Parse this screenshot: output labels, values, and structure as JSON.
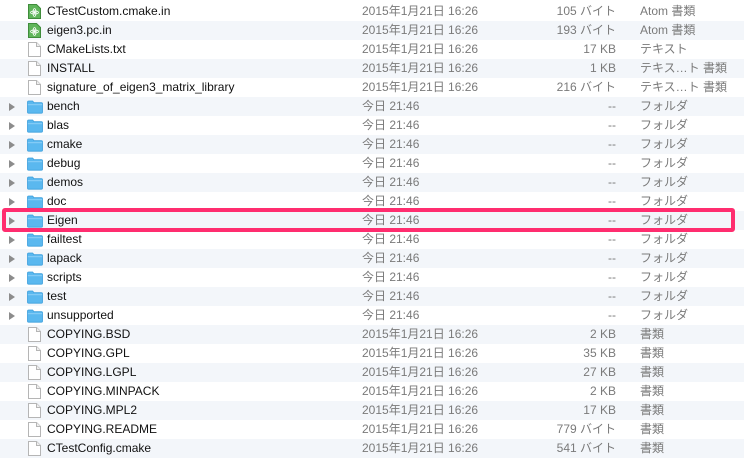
{
  "files": [
    {
      "name": "CTestCustom.cmake.in",
      "date": "2015年1月21日 16:26",
      "size": "105 バイト",
      "kind": "Atom 書類",
      "icon": "atom-document-icon",
      "folder": false
    },
    {
      "name": "eigen3.pc.in",
      "date": "2015年1月21日 16:26",
      "size": "193 バイト",
      "kind": "Atom 書類",
      "icon": "atom-document-icon",
      "folder": false
    },
    {
      "name": "CMakeLists.txt",
      "date": "2015年1月21日 16:26",
      "size": "17 KB",
      "kind": "テキスト",
      "icon": "document-icon",
      "folder": false
    },
    {
      "name": "INSTALL",
      "date": "2015年1月21日 16:26",
      "size": "1 KB",
      "kind": "テキス…ト 書類",
      "icon": "document-icon",
      "folder": false
    },
    {
      "name": "signature_of_eigen3_matrix_library",
      "date": "2015年1月21日 16:26",
      "size": "216 バイト",
      "kind": "テキス…ト 書類",
      "icon": "document-icon",
      "folder": false
    },
    {
      "name": "bench",
      "date": "今日 21:46",
      "size": "--",
      "kind": "フォルダ",
      "icon": "folder-icon",
      "folder": true
    },
    {
      "name": "blas",
      "date": "今日 21:46",
      "size": "--",
      "kind": "フォルダ",
      "icon": "folder-icon",
      "folder": true
    },
    {
      "name": "cmake",
      "date": "今日 21:46",
      "size": "--",
      "kind": "フォルダ",
      "icon": "folder-icon",
      "folder": true
    },
    {
      "name": "debug",
      "date": "今日 21:46",
      "size": "--",
      "kind": "フォルダ",
      "icon": "folder-icon",
      "folder": true
    },
    {
      "name": "demos",
      "date": "今日 21:46",
      "size": "--",
      "kind": "フォルダ",
      "icon": "folder-icon",
      "folder": true
    },
    {
      "name": "doc",
      "date": "今日 21:46",
      "size": "--",
      "kind": "フォルダ",
      "icon": "folder-icon",
      "folder": true
    },
    {
      "name": "Eigen",
      "date": "今日 21:46",
      "size": "--",
      "kind": "フォルダ",
      "icon": "folder-icon",
      "folder": true
    },
    {
      "name": "failtest",
      "date": "今日 21:46",
      "size": "--",
      "kind": "フォルダ",
      "icon": "folder-icon",
      "folder": true
    },
    {
      "name": "lapack",
      "date": "今日 21:46",
      "size": "--",
      "kind": "フォルダ",
      "icon": "folder-icon",
      "folder": true
    },
    {
      "name": "scripts",
      "date": "今日 21:46",
      "size": "--",
      "kind": "フォルダ",
      "icon": "folder-icon",
      "folder": true
    },
    {
      "name": "test",
      "date": "今日 21:46",
      "size": "--",
      "kind": "フォルダ",
      "icon": "folder-icon",
      "folder": true
    },
    {
      "name": "unsupported",
      "date": "今日 21:46",
      "size": "--",
      "kind": "フォルダ",
      "icon": "folder-icon",
      "folder": true
    },
    {
      "name": "COPYING.BSD",
      "date": "2015年1月21日 16:26",
      "size": "2 KB",
      "kind": "書類",
      "icon": "document-icon",
      "folder": false
    },
    {
      "name": "COPYING.GPL",
      "date": "2015年1月21日 16:26",
      "size": "35 KB",
      "kind": "書類",
      "icon": "document-icon",
      "folder": false
    },
    {
      "name": "COPYING.LGPL",
      "date": "2015年1月21日 16:26",
      "size": "27 KB",
      "kind": "書類",
      "icon": "document-icon",
      "folder": false
    },
    {
      "name": "COPYING.MINPACK",
      "date": "2015年1月21日 16:26",
      "size": "2 KB",
      "kind": "書類",
      "icon": "document-icon",
      "folder": false
    },
    {
      "name": "COPYING.MPL2",
      "date": "2015年1月21日 16:26",
      "size": "17 KB",
      "kind": "書類",
      "icon": "document-icon",
      "folder": false
    },
    {
      "name": "COPYING.README",
      "date": "2015年1月21日 16:26",
      "size": "779 バイト",
      "kind": "書類",
      "icon": "document-icon",
      "folder": false
    },
    {
      "name": "CTestConfig.cmake",
      "date": "2015年1月21日 16:26",
      "size": "541 バイト",
      "kind": "書類",
      "icon": "document-icon",
      "folder": false
    }
  ],
  "highlighted_item": "Eigen",
  "colors": {
    "highlight": "#ff2d6f",
    "folder": "#5ab8ef",
    "alt_row": "#f3f6fa",
    "atom_badge": "#5fb55a"
  }
}
